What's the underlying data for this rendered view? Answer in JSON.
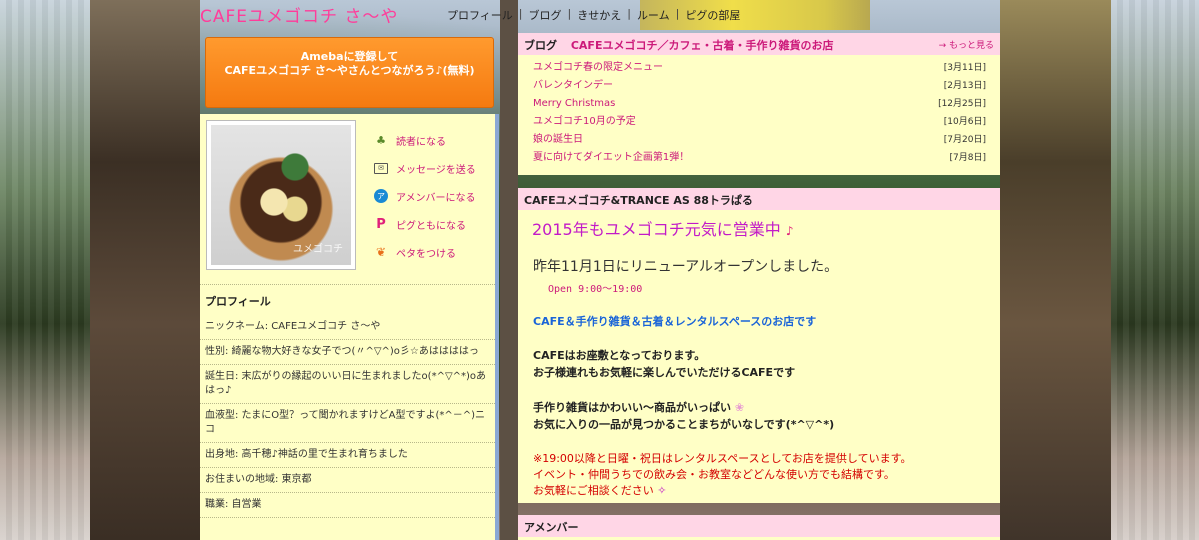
{
  "header": {
    "site_title": "CAFEユメゴコチ さ〜や",
    "nav": [
      "プロフィール",
      "ブログ",
      "きせかえ",
      "ルーム",
      "ピグの部屋"
    ]
  },
  "left": {
    "ameba_button": "Amebaに登録して\nCAFEユメゴコチ さ〜やさんとつながろう♪(無料)",
    "avatar_caption": "ユメゴコチ",
    "actions": [
      {
        "label": "読者になる",
        "icon": "reader-icon"
      },
      {
        "label": "メッセージを送る",
        "icon": "mail-icon"
      },
      {
        "label": "アメンバーになる",
        "icon": "amember-icon"
      },
      {
        "label": "ピグともになる",
        "icon": "pigg-icon"
      },
      {
        "label": "ペタをつける",
        "icon": "footprint-icon"
      }
    ],
    "profile": {
      "heading": "プロフィール",
      "rows": [
        "ニックネーム: CAFEユメゴコチ さ〜や",
        "性別: 綺麗な物大好きな女子でつ(〃^▽^)o彡☆あははははっ",
        "誕生日: 末広がりの縁起のいい日に生まれましたo(*^▽^*)oあはっ♪",
        "血液型: たまにO型？って聞かれますけどA型ですよ(*^－^)ニコ",
        "出身地: 高千穂♪神話の里で生まれ育ちました",
        "お住まいの地域: 東京都",
        "職業: 自営業"
      ]
    }
  },
  "blog": {
    "label": "ブログ",
    "title": "CAFEユメゴコチ／カフェ・古着・手作り雑貨のお店",
    "more": "→ もっと見る",
    "entries": [
      {
        "title": "ユメゴコチ春の限定メニュー",
        "date": "[3月11日]"
      },
      {
        "title": "バレンタインデー",
        "date": "[2月13日]"
      },
      {
        "title": "Merry Christmas",
        "date": "[12月25日]"
      },
      {
        "title": "ユメゴコチ10月の予定",
        "date": "[10月6日]"
      },
      {
        "title": "娘の誕生日",
        "date": "[7月20日]"
      },
      {
        "title": "夏に向けてダイエット企画第1弾！",
        "date": "[7月8日]"
      }
    ]
  },
  "post": {
    "header": "CAFEユメゴコチ&TRANCE AS 88トラぱる",
    "title": "2015年もユメゴコチ元気に営業中",
    "line1": "昨年11月1日にリニューアルオープンしました。",
    "open": "Open  9:00〜19:00",
    "blue": "CAFE＆手作り雑貨＆古着＆レンタルスペースのお店です",
    "black1": "CAFEはお座敷となっております。",
    "black2": "お子様連れもお気軽に楽しんでいただけるCAFEです",
    "black3": "手作り雑貨はかわいい〜商品がいっぱい",
    "black4": "お気に入りの一品が見つかることまちがいなしです(*^▽^*)",
    "red1": "※19:00以降と日曜・祝日はレンタルスペースとしてお店を提供しています。",
    "red2": "イベント・仲間うちでの飲み会・お教室などどんな使い方でも結構です。",
    "red3": "お気軽にご相談ください"
  },
  "member": {
    "header": "アメンバー"
  },
  "colors": {
    "accent_pink": "#cc1a7a",
    "header_pink": "#ffd6e6",
    "panel_yellow": "#ffffc6",
    "ameba_orange": "#f57a10",
    "title_magenta": "#ff3c9a"
  }
}
